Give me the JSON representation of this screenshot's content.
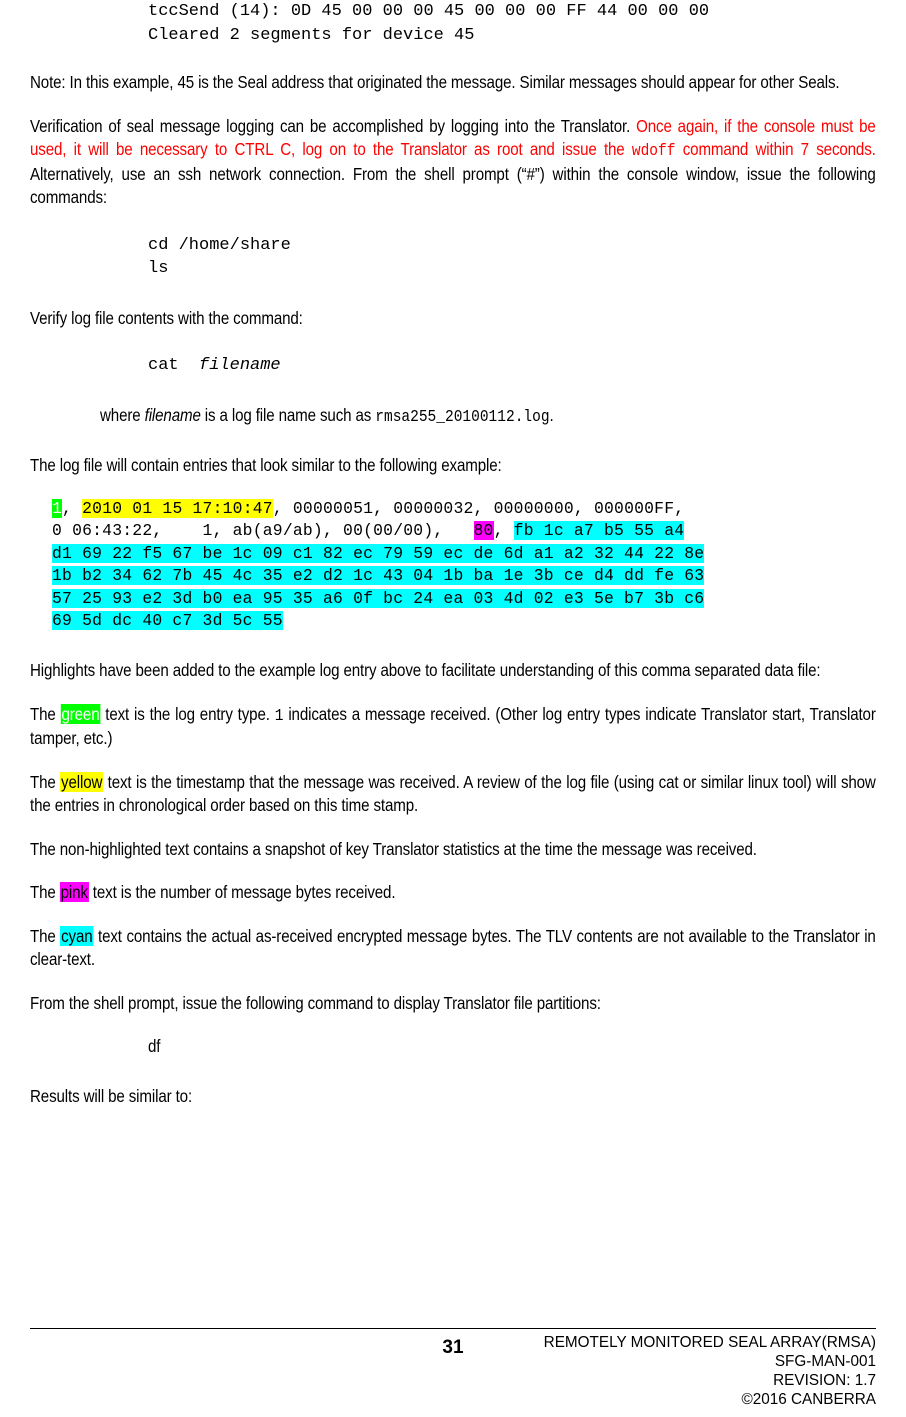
{
  "top_console": {
    "line1": "tccSend (14): 0D 45 00 00 00 45 00 00 00 FF 44 00 00 00",
    "line2": "Cleared 2 segments for device 45"
  },
  "paragraphs": {
    "note": "Note:  In this example, 45 is the Seal address that originated the message.  Similar messages should appear for other Seals.",
    "verification_part1": "Verification of seal message logging can be accomplished by logging into the Translator. ",
    "verification_red1": "Once again, if the console must be used, it will be necessary to CTRL C, log on to the Translator as root and issue the ",
    "verification_red_mono": "wdoff",
    "verification_red2": " command within 7 seconds.",
    "verification_part2": "  Alternatively, use an ssh network connection.    From the shell prompt (“#”) within the console window, issue the following commands:",
    "verify_log": "Verify log file contents with the command:",
    "where_pre": "where ",
    "where_italic": "filename",
    "where_mid": " is a log file name such as ",
    "where_mono": "rmsa255_20100112.log",
    "where_post": ".",
    "log_intro": "The log file will contain entries that look similar to the following example:",
    "highlights_intro": "Highlights have been added to the example log entry above to facilitate understanding of this comma separated data file:",
    "green_pre": "The ",
    "green_word": "green",
    "green_post1": " text is the log entry type. ",
    "green_mono": "1",
    "green_post2": " indicates a message received.  (Other log entry types indicate Translator start, Translator tamper, etc.)",
    "yellow_pre": "The ",
    "yellow_word": "yellow",
    "yellow_post": "  text is the timestamp that the message was received.  A review of the log file (using cat or similar linux tool) will show the entries in chronological order based on this time stamp.",
    "nonhighlighted": "The non-highlighted text contains a snapshot of key Translator statistics at the time the message was received.",
    "pink_pre": "The ",
    "pink_word": "pink",
    "pink_post": " text is the number of message bytes received.",
    "cyan_pre": "The ",
    "cyan_word": "cyan",
    "cyan_post": " text contains the actual as-received encrypted message bytes.  The TLV contents are not available to the Translator in clear-text.",
    "df_intro": "From the shell prompt, issue the following command to display Translator file partitions:",
    "results": "Results will be similar to:"
  },
  "commands": {
    "cd_home_share": "cd /home/share",
    "ls": "ls",
    "cat_cmd": "cat  ",
    "cat_filename": "filename",
    "df": "df"
  },
  "log_example": {
    "entry_type": "1",
    "sep1": ", ",
    "timestamp": "2010 01 15 17:10:47",
    "stats_line1": ", 00000051, 00000032, 00000000, 000000FF,",
    "stats_line2_pre": "0 06:43:22,    1, ab(a9/ab), 00(00/00),   ",
    "byte_count": "80",
    "sep2": ", ",
    "hex_line1": "fb 1c a7 b5 55 a4",
    "hex_line2": "d1 69 22 f5 67 be 1c 09 c1 82 ec 79 59 ec de 6d a1 a2 32 44 22 8e",
    "hex_line3": "1b b2 34 62 7b 45 4c 35 e2 d2 1c 43 04 1b ba 1e 3b ce d4 dd fe 63",
    "hex_line4": "57 25 93 e2 3d b0 ea 95 35 a6 0f bc 24 ea 03 4d 02 e3 5e b7 3b c6",
    "hex_line5": "69 5d dc 40 c7 3d 5c 55"
  },
  "colors": {
    "green": "#00ff00",
    "yellow": "#ffff00",
    "pink": "#ff00ff",
    "cyan": "#00ffff",
    "red_text": "#ff0000"
  },
  "footer": {
    "page_number": "31",
    "title": "REMOTELY MONITORED SEAL ARRAY(RMSA)",
    "doc_id": "SFG-MAN-001",
    "revision": "REVISION: 1.7",
    "copyright": "©2016 CANBERRA"
  }
}
